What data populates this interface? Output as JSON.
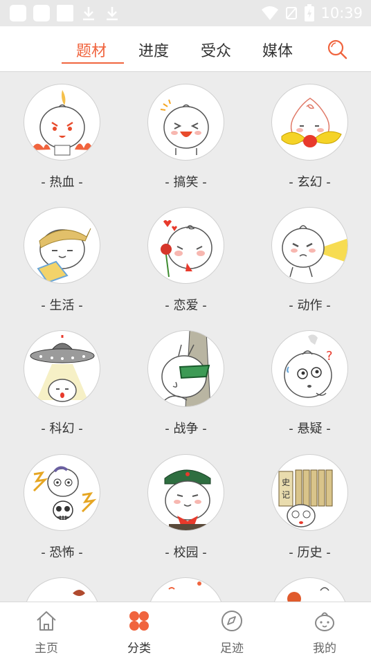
{
  "status_bar": {
    "time": "10:39"
  },
  "top_tabs": [
    {
      "label": "题材",
      "active": true
    },
    {
      "label": "进度",
      "active": false
    },
    {
      "label": "受众",
      "active": false
    },
    {
      "label": "媒体",
      "active": false
    }
  ],
  "categories": [
    {
      "label": "- 热血 -",
      "icon": "fire-bun-icon"
    },
    {
      "label": "- 搞笑 -",
      "icon": "laughing-bun-icon"
    },
    {
      "label": "- 玄幻 -",
      "icon": "ribbon-bun-icon"
    },
    {
      "label": "- 生活 -",
      "icon": "bandana-bun-icon"
    },
    {
      "label": "- 恋爱 -",
      "icon": "rose-bun-icon"
    },
    {
      "label": "- 动作 -",
      "icon": "laser-bun-icon"
    },
    {
      "label": "- 科幻 -",
      "icon": "ufo-bun-icon"
    },
    {
      "label": "- 战争 -",
      "icon": "soldier-bun-icon"
    },
    {
      "label": "- 悬疑 -",
      "icon": "confused-bun-icon"
    },
    {
      "label": "- 恐怖 -",
      "icon": "skull-bun-icon"
    },
    {
      "label": "- 校园 -",
      "icon": "student-bun-icon"
    },
    {
      "label": "- 历史 -",
      "icon": "scroll-bun-icon"
    }
  ],
  "bottom_nav": [
    {
      "label": "主页",
      "icon": "home-icon",
      "active": false
    },
    {
      "label": "分类",
      "icon": "category-icon",
      "active": true
    },
    {
      "label": "足迹",
      "icon": "compass-icon",
      "active": false
    },
    {
      "label": "我的",
      "icon": "profile-icon",
      "active": false
    }
  ],
  "colors": {
    "accent": "#f0643e",
    "background": "#ececec",
    "statusbar": "#e8e8e8"
  }
}
